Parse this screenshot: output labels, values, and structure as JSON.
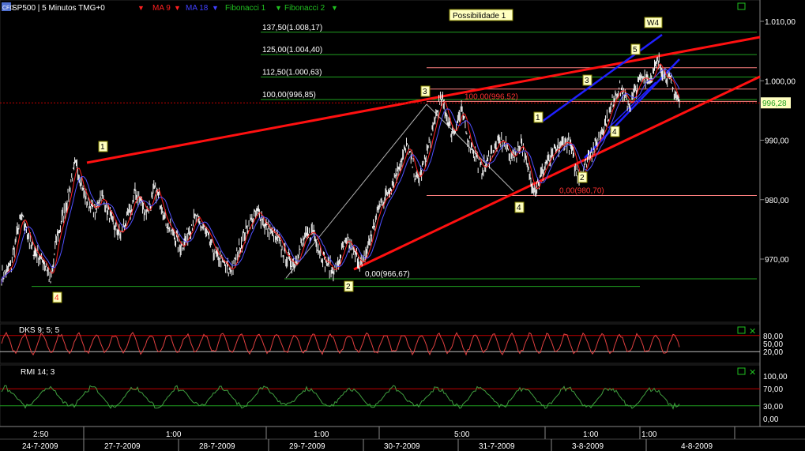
{
  "header": {
    "symbol": "SP500 | 5 Minutos TMG+0",
    "indicators": [
      {
        "label": "MA 9",
        "color": "#ff2020"
      },
      {
        "label": "MA 18",
        "color": "#4040ff"
      },
      {
        "label": "Fibonacci 1",
        "color": "#20c020"
      },
      {
        "label": "Fibonacci 2",
        "color": "#20c020"
      }
    ],
    "badge": "Possibilidade 1",
    "wave_tag": "W4"
  },
  "chart_data": [
    {
      "type": "line",
      "series": [
        {
          "name": "SP500",
          "values": [
            967,
            968,
            969,
            974,
            977,
            975,
            972,
            971,
            970,
            969,
            966,
            973,
            976,
            979,
            983,
            986,
            983,
            980,
            979,
            978,
            981,
            979,
            977,
            975,
            974,
            976,
            978,
            981,
            980,
            978,
            979,
            982,
            980,
            977,
            975,
            974,
            972,
            973,
            975,
            977,
            976,
            975,
            973,
            971,
            970,
            969,
            968,
            969,
            972,
            974,
            976,
            977,
            978,
            976,
            975,
            974,
            973,
            971,
            970,
            969,
            971,
            973,
            974,
            975,
            972,
            970,
            969,
            968,
            969,
            972,
            973,
            971,
            970,
            969,
            972,
            975,
            978,
            980,
            981,
            983,
            985,
            987,
            989,
            986,
            983,
            985,
            988,
            991,
            995,
            997,
            994,
            991,
            993,
            995,
            991,
            989,
            987,
            985,
            986,
            988,
            989,
            990,
            989,
            987,
            988,
            990,
            986,
            983,
            982,
            984,
            986,
            987,
            988,
            989,
            990,
            989,
            985,
            984,
            986,
            988,
            989,
            991,
            993,
            995,
            998,
            999,
            997,
            996,
            998,
            1000,
            1001,
            1000,
            1002,
            1003,
            1001,
            1000,
            998,
            996
          ]
        }
      ],
      "y_axis_ticks": [
        "1.010,00",
        "1.000,00",
        "990,00",
        "980,00",
        "970,00"
      ],
      "ylim": [
        963,
        1013
      ],
      "last_price": "996,28",
      "x_time_labels": [
        "2:50",
        "1:00",
        "1:00",
        "5:00",
        "1:00",
        "1:00"
      ],
      "x_date_labels": [
        "24-7-2009",
        "27-7-2009",
        "28-7-2009",
        "29-7-2009",
        "30-7-2009",
        "31-7-2009",
        "3-8-2009",
        "4-8-2009"
      ],
      "fibonacci_levels": [
        {
          "label": "137,50(1.008,17)",
          "value": 1008.17
        },
        {
          "label": "125,00(1.004,40)",
          "value": 1004.4
        },
        {
          "label": "112,50(1.000,63)",
          "value": 1000.63
        },
        {
          "label": "100,00(996,85)",
          "value": 996.85
        },
        {
          "label": "100,00(996,52)",
          "value": 996.52
        },
        {
          "label": "0,00(980,70)",
          "value": 980.7
        },
        {
          "label": "0,00(966,67)",
          "value": 966.67
        }
      ],
      "wave_labels": [
        "1",
        "2",
        "3",
        "4",
        "5",
        "1",
        "2",
        "3",
        "4",
        "4"
      ]
    },
    {
      "type": "line",
      "title": "DKS 9; 5; 5",
      "y_axis_ticks": [
        "80,00",
        "50,00",
        "20,00"
      ],
      "ylim": [
        0,
        100
      ]
    },
    {
      "type": "line",
      "title": "RMI 14; 3",
      "y_axis_ticks": [
        "100,00",
        "70,00",
        "30,00",
        "0,00"
      ],
      "ylim": [
        0,
        100
      ]
    }
  ]
}
